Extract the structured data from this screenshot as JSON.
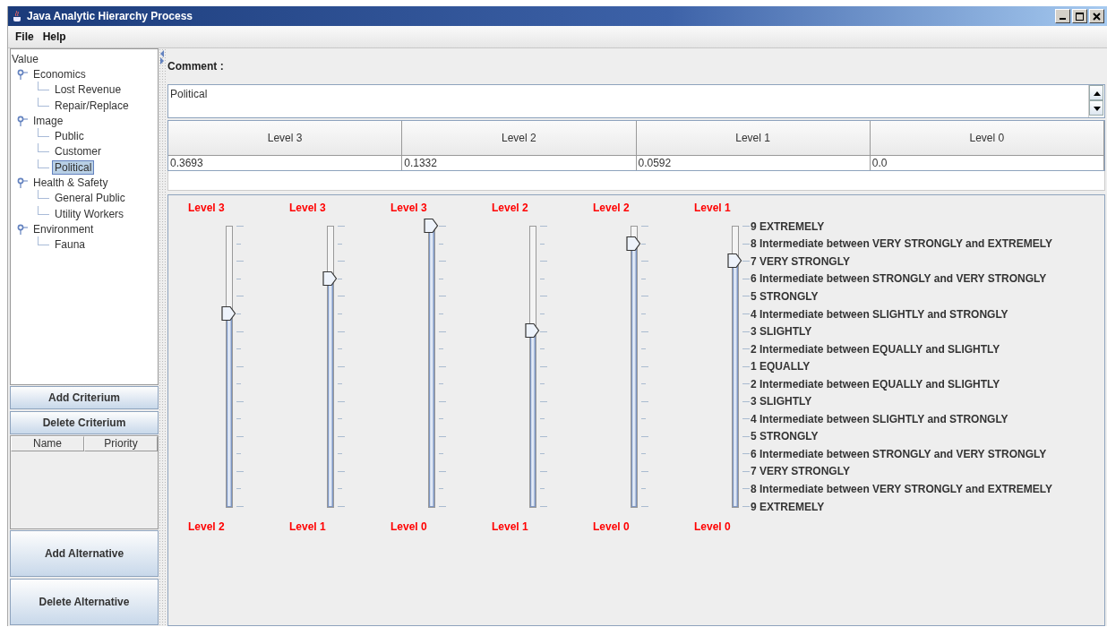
{
  "window": {
    "title": "Java Analytic Hierarchy Process"
  },
  "menu": [
    "File",
    "Help"
  ],
  "tree": {
    "label": "Value",
    "selected": false,
    "children": [
      {
        "label": "Economics",
        "selected": false,
        "expanded": true,
        "children": [
          {
            "label": "Lost Revenue",
            "selected": false
          },
          {
            "label": "Repair/Replace",
            "selected": false
          }
        ]
      },
      {
        "label": "Image",
        "selected": false,
        "expanded": true,
        "children": [
          {
            "label": "Public",
            "selected": false
          },
          {
            "label": "Customer",
            "selected": false
          },
          {
            "label": "Political",
            "selected": true
          }
        ]
      },
      {
        "label": "Health & Safety",
        "selected": false,
        "expanded": true,
        "children": [
          {
            "label": "General Public",
            "selected": false
          },
          {
            "label": "Utility Workers",
            "selected": false
          }
        ]
      },
      {
        "label": "Environment",
        "selected": false,
        "expanded": true,
        "children": [
          {
            "label": "Fauna",
            "selected": false
          }
        ]
      }
    ]
  },
  "criterion_buttons": [
    "Add Criterium",
    "Delete Criterium"
  ],
  "priority_table": {
    "columns": [
      "Name",
      "Priority"
    ]
  },
  "alternative_buttons": [
    "Add Alternative",
    "Delete Alternative"
  ],
  "comment": {
    "label": "Comment :",
    "value": "Political"
  },
  "levels_table": {
    "columns": [
      "Level 3",
      "Level 2",
      "Level 1",
      "Level 0"
    ],
    "rows": [
      [
        "0.3693",
        "0.1332",
        "0.0592",
        "0.0"
      ]
    ]
  },
  "sliders": [
    {
      "kind": "plain",
      "top_label": "Level 3",
      "bottom_label": "Level 2",
      "level": 0.6875
    },
    {
      "kind": "plain",
      "top_label": "Level 3",
      "bottom_label": "Level 1",
      "level": 0.8125
    },
    {
      "kind": "plain",
      "top_label": "Level 3",
      "bottom_label": "Level 0",
      "level": 1.0
    },
    {
      "kind": "plain",
      "top_label": "Level 2",
      "bottom_label": "Level 1",
      "level": 0.625
    },
    {
      "kind": "plain",
      "top_label": "Level 2",
      "bottom_label": "Level 0",
      "level": 0.9375
    },
    {
      "kind": "labeled",
      "top_label": "Level 1",
      "bottom_label": "Level 0",
      "level": 0.875
    }
  ],
  "scale_labels": [
    "9 EXTREMELY",
    "8 Intermediate between VERY STRONGLY and EXTREMELY",
    "7 VERY STRONGLY",
    "6 Intermediate between STRONGLY and VERY STRONGLY",
    "5 STRONGLY",
    "4 Intermediate between SLIGHTLY and STRONGLY",
    "3 SLIGHTLY",
    "2 Intermediate between EQUALLY and SLIGHTLY",
    "1 EQUALLY",
    "2 Intermediate between EQUALLY and SLIGHTLY",
    "3 SLIGHTLY",
    "4 Intermediate between SLIGHTLY and STRONGLY",
    "5 STRONGLY",
    "6 Intermediate between STRONGLY and VERY STRONGLY",
    "7 VERY STRONGLY",
    "8 Intermediate between VERY STRONGLY and EXTREMELY",
    "9 EXTREMELY"
  ]
}
